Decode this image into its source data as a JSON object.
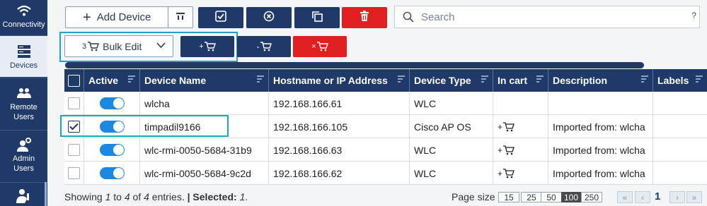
{
  "sidebar": {
    "items": [
      {
        "label": "Connectivity",
        "icon": "wifi-icon"
      },
      {
        "label": "Devices",
        "icon": "server-icon"
      },
      {
        "label": "Remote Users",
        "icon": "users-icon"
      },
      {
        "label": "Admin Users",
        "icon": "admin-user-icon"
      },
      {
        "label": "",
        "icon": "user-key-icon"
      }
    ]
  },
  "toolbar": {
    "add_device_label": "Add Device",
    "bulk_edit_count": "3",
    "bulk_edit_label": "Bulk Edit",
    "add_to_cart_label": "+",
    "remove_from_cart_label": "-",
    "clear_cart_label": "×",
    "search_placeholder": "Search",
    "search_help": "?"
  },
  "table": {
    "headers": [
      "Active",
      "Device Name",
      "Hostname or IP Address",
      "Device Type",
      "In cart",
      "Description",
      "Labels"
    ],
    "rows": [
      {
        "selected": false,
        "active": true,
        "name": "wlcha",
        "host": "192.168.166.61",
        "type": "WLC",
        "cart": "",
        "description": ""
      },
      {
        "selected": true,
        "active": true,
        "name": "timpadil9166",
        "host": "192.168.166.105",
        "type": "Cisco AP OS",
        "cart": "+",
        "description": "Imported from: wlcha"
      },
      {
        "selected": false,
        "active": true,
        "name": "wlc-rmi-0050-5684-31b9",
        "host": "192.168.166.63",
        "type": "WLC",
        "cart": "+",
        "description": "Imported from: wlcha"
      },
      {
        "selected": false,
        "active": true,
        "name": "wlc-rmi-0050-5684-9c2d",
        "host": "192.168.166.62",
        "type": "WLC",
        "cart": "+",
        "description": "Imported from: wlcha"
      }
    ]
  },
  "footer": {
    "showing_prefix": "Showing ",
    "from": "1",
    "to_word": " to ",
    "to": "4",
    "of_word": " of ",
    "total": "4",
    "entries_word": " entries. ",
    "selected_label": "| Selected: ",
    "selected_count": "1",
    "selected_suffix": ".",
    "page_size_label": "Page size",
    "page_sizes": [
      "15",
      "25",
      "50",
      "100",
      "250"
    ],
    "current_page": "1"
  },
  "colors": {
    "navy": "#1f3a68",
    "red": "#e02020",
    "toggle_blue": "#1b88e2",
    "highlight": "#21a3c4"
  }
}
